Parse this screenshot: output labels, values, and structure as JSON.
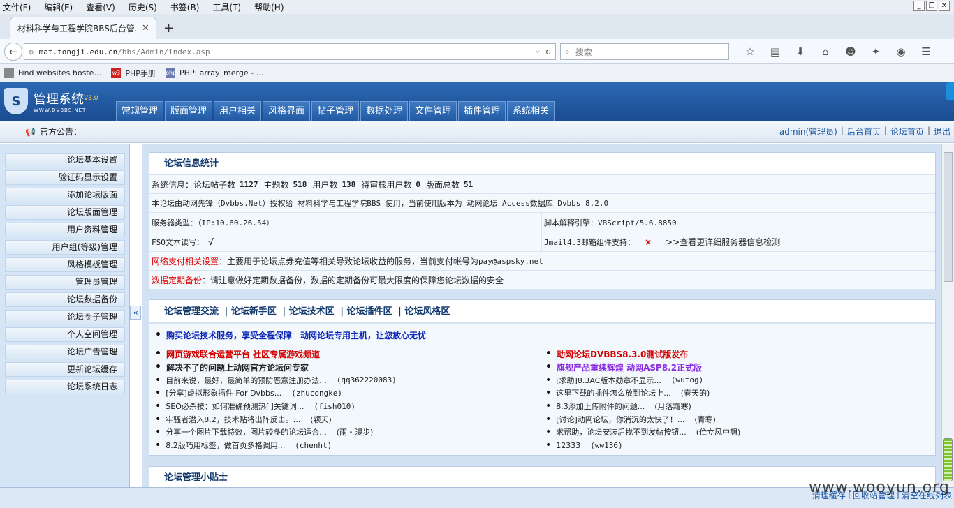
{
  "browser": {
    "menu": [
      "文件(F)",
      "编辑(E)",
      "查看(V)",
      "历史(S)",
      "书签(B)",
      "工具(T)",
      "帮助(H)"
    ],
    "tab_title": "材料科学与工程学院BBS后台管…",
    "url_host": "mat.tongji.edu.cn",
    "url_path": "/bbs/Admin/index.asp",
    "search_placeholder": "搜索",
    "bookmarks": [
      "Find websites hoste…",
      "PHP手册",
      "PHP: array_merge - …"
    ],
    "bookmark_icons": [
      "page-icon",
      "w3-icon",
      "php-icon"
    ],
    "toolbar_icons": [
      "star-icon",
      "reader-icon",
      "download-icon",
      "home-icon",
      "chat-icon",
      "addon-icon",
      "globe-icon",
      "menu-icon"
    ]
  },
  "app": {
    "logo_name": "管理系统",
    "logo_version": "V3.0",
    "logo_sub": "WWW.DVBBS.NET",
    "nav": [
      "常规管理",
      "版面管理",
      "用户相关",
      "风格界面",
      "帖子管理",
      "数据处理",
      "文件管理",
      "插件管理",
      "系统相关"
    ],
    "notice_label": "官方公告：",
    "user_links": [
      "admin(管理员)",
      "后台首页",
      "论坛首页",
      "退出"
    ],
    "sidebar": [
      "论坛基本设置",
      "验证码显示设置",
      "添加论坛版面",
      "论坛版面管理",
      "用户资料管理",
      "用户组(等级)管理",
      "风格模板管理",
      "管理员管理",
      "论坛数据备份",
      "论坛圈子管理",
      "个人空间管理",
      "论坛广告管理",
      "更新论坛缓存",
      "论坛系统日志"
    ],
    "collapse_label": "«"
  },
  "stats": {
    "title": "论坛信息统计",
    "sysinfo_label": "系统信息：",
    "items": [
      {
        "label": "论坛帖子数",
        "value": "1127"
      },
      {
        "label": "主题数",
        "value": "518"
      },
      {
        "label": "用户数",
        "value": "138"
      },
      {
        "label": "待审核用户数",
        "value": "0"
      },
      {
        "label": "版面总数",
        "value": "51"
      }
    ],
    "license": "本论坛由动网先锋（Dvbbs.Net）授权给 材料科学与工程学院BBS 使用，当前使用版本为 动网论坛 Access数据库 Dvbbs 8.2.0",
    "server_type": "服务器类型：（IP:10.60.26.54）",
    "script_engine": "脚本解释引擎：VBScript/5.6.8850",
    "fso_label": "FSO文本读写：",
    "fso_value": "√",
    "jmail_label": "Jmail4.3邮箱组件支持：",
    "jmail_value": "×",
    "detail_link": ">>查看更详细服务器信息检测",
    "payment_label": "网络支付相关设置",
    "payment_text": "：主要用于论坛点券充值等相关导致论坛收益的服务，当前支付帐号为",
    "payment_account": "pay@aspsky.net",
    "backup_label": "数据定期备份",
    "backup_text": "：请注意做好定期数据备份，数据的定期备份可最大限度的保障您论坛数据的安全"
  },
  "community": {
    "links": [
      "论坛管理交流",
      "论坛新手区",
      "论坛技术区",
      "论坛插件区",
      "论坛风格区"
    ],
    "lead": "购买论坛技术服务，享受全程保障　动网论坛专用主机，让您放心无忧",
    "left": [
      {
        "text": "网页游戏联合运营平台 社区专属游戏频道",
        "author": "",
        "color": "#d40000",
        "bold": true
      },
      {
        "text": "解决不了的问题上动网官方论坛问专家",
        "author": "",
        "color": "#111111",
        "bold": true
      },
      {
        "text": "目前来说，最好，最简单的预防恶意注册办法...",
        "author": "(qq362220083)"
      },
      {
        "text": "[分享]虚拟形象插件 For Dvbbs...",
        "author": "(zhucongke)"
      },
      {
        "text": "SEO必杀技：如何准确预测热门关键词...",
        "author": "(fish010)"
      },
      {
        "text": "牢骚者潜入8.2，技术贴将出阵反击。...",
        "author": "(颖天)"
      },
      {
        "text": "分享一个图片下载特效，图片较多的论坛适合...",
        "author": "(雨・漫步)"
      },
      {
        "text": "8.2版巧用标签，做首页多格调用...",
        "author": "(chenht)"
      }
    ],
    "right": [
      {
        "text": "动网论坛DVBBS8.3.0测试版发布",
        "author": "",
        "color": "#d40000",
        "bold": true
      },
      {
        "text": "旗舰产品重续辉煌 动网ASP8.2正式版",
        "author": "",
        "color": "#8a2be2",
        "bold": true
      },
      {
        "text": "[求助]8.3AC版本勋章不显示...",
        "author": "(wutog)"
      },
      {
        "text": "这里下载的插件怎么放到论坛上...",
        "author": "(春天的)"
      },
      {
        "text": "8.3添加上传附件的问题...",
        "author": "(月落霜寒)"
      },
      {
        "text": "[讨论]动网论坛，你消沉的太快了！...",
        "author": "(青寒)"
      },
      {
        "text": "求帮助，论坛安装后找不到发帖按钮...",
        "author": "(伫立风中想)"
      },
      {
        "text": "12333",
        "author": "(ww136)"
      }
    ]
  },
  "tips": {
    "title": "论坛管理小贴士"
  },
  "footer_links": [
    "清理缓存",
    "回收站管理",
    "清空在线列表"
  ],
  "watermark": "www.wooyun.org"
}
